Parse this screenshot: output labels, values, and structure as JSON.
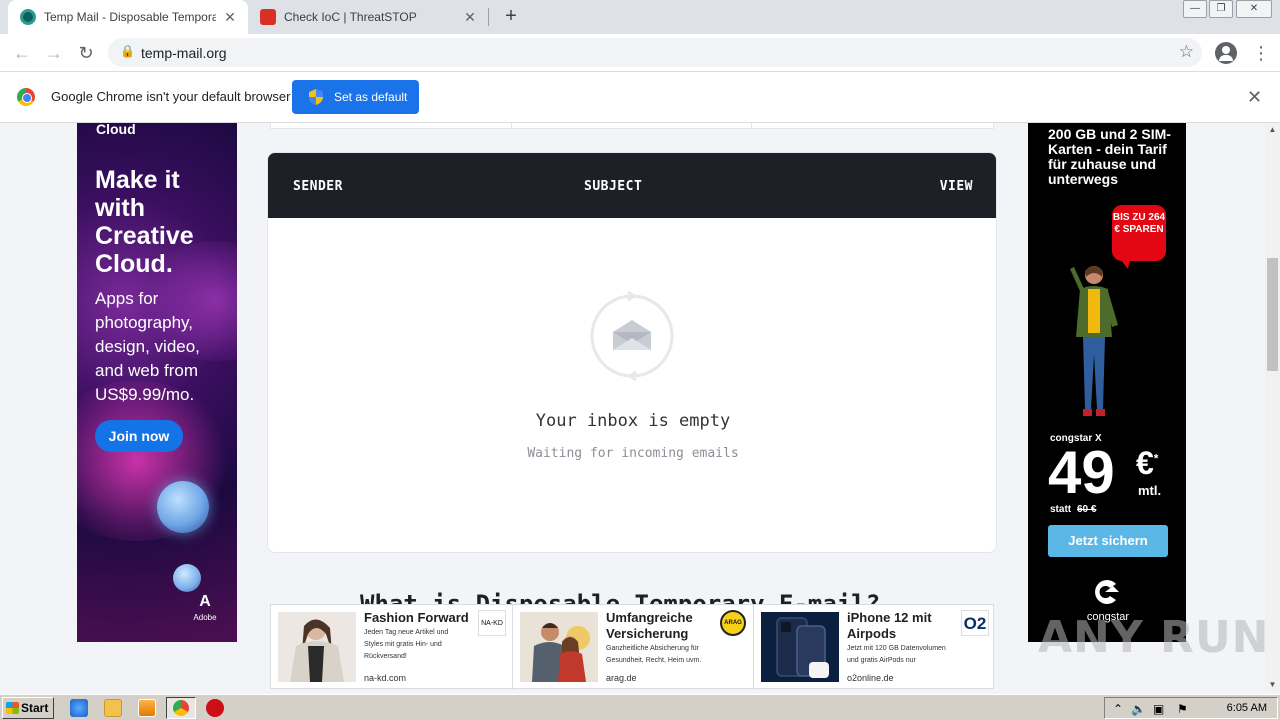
{
  "browser": {
    "tabs": [
      {
        "title": "Temp Mail - Disposable Temporary E",
        "active": true
      },
      {
        "title": "Check IoC | ThreatSTOP",
        "active": false
      }
    ],
    "new_tab": "+",
    "window_controls": {
      "minimize": "—",
      "restore": "❐",
      "close": "✕"
    },
    "url": "temp-mail.org",
    "nav": {
      "back": "←",
      "forward": "→",
      "reload": "↻"
    },
    "star": "☆",
    "menu": "⋮"
  },
  "infobar": {
    "message": "Google Chrome isn't your default browser",
    "button": "Set as default",
    "close": "✕"
  },
  "ad_left": {
    "top_text": "Cloud",
    "headline": "Make it with Creative Cloud.",
    "body": "Apps for photography, design, video, and web from US$9.99/mo.",
    "button": "Join now",
    "brand": "Adobe"
  },
  "inbox": {
    "columns": {
      "sender": "SENDER",
      "subject": "SUBJECT",
      "view": "VIEW"
    },
    "empty_title": "Your inbox is empty",
    "empty_subtitle": "Waiting for incoming emails"
  },
  "section_heading": "What is Disposable Temporary E-mail?",
  "ad_right": {
    "headline": "200 GB und 2 SIM-Karten - dein Tarif für zuhause und unterwegs",
    "bubble": "BIS ZU 264 € SPAREN",
    "brand_line": "congstar X",
    "price": "49",
    "currency": "€",
    "asterisk": "*",
    "period": "mtl.",
    "statt_label": "statt",
    "statt_value": "60 €",
    "button": "Jetzt sichern",
    "brand": "congstar"
  },
  "ad_bottom": [
    {
      "title": "Fashion Forward",
      "desc": "Jeden Tag neue Artikel und Styles mit gratis Hin- und Rückversand!",
      "domain": "na-kd.com",
      "logo": "NA-KD"
    },
    {
      "title": "Umfangreiche Versicherung",
      "desc": "Ganzheitliche Absicherung für Gesundheit, Recht, Heim uvm.",
      "domain": "arag.de",
      "logo": "ARAG"
    },
    {
      "title": "iPhone 12 mit Airpods",
      "desc": "Jetzt mit 120 GB Datenvolumen und gratis AirPods nur",
      "domain": "o2online.de",
      "logo": "O2"
    }
  ],
  "watermark": "ANY RUN",
  "taskbar": {
    "start": "Start",
    "clock": "6:05 AM"
  },
  "colors": {
    "inbox_header": "#1d2026",
    "chrome_blue": "#1a73e8",
    "congstar_cta": "#5bb8e6",
    "congstar_red": "#e30613",
    "adobe_join": "#1473e6"
  }
}
